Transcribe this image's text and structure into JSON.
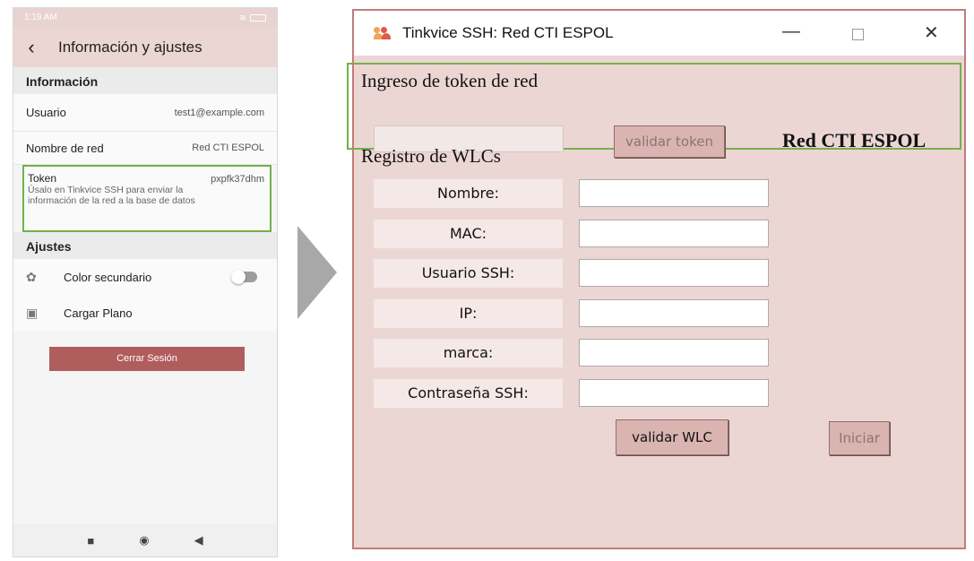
{
  "phone": {
    "status_time": "1:19 AM",
    "back_glyph": "‹",
    "title": "Información y ajustes",
    "info_section": "Información",
    "rows": [
      {
        "label": "Usuario",
        "value": "test1@example.com"
      },
      {
        "label": "Nombre de red",
        "value": "Red CTI ESPOL"
      }
    ],
    "token": {
      "label": "Token",
      "description": "Úsalo en Tinkvice SSH para enviar la información de la red a la base de datos",
      "value": "pxpfk37dhm"
    },
    "settings_section": "Ajustes",
    "settings": [
      {
        "label": "Color secundario",
        "icon": "palette-icon"
      },
      {
        "label": "Cargar Plano",
        "icon": "image-icon"
      }
    ],
    "logout_label": "Cerrar Sesión",
    "nav": {
      "recents": "■",
      "home": "◉",
      "back": "◀"
    }
  },
  "window": {
    "title": "Tinkvice SSH: Red CTI ESPOL",
    "minimize_glyph": "—",
    "close_glyph": "✕",
    "token_heading": "Ingreso de token de red",
    "validate_token_label": "validar token",
    "network_name": "Red CTI ESPOL",
    "wlc_heading": "Registro de WLCs",
    "fields": [
      "Nombre:",
      "MAC:",
      "Usuario SSH:",
      "IP:",
      "marca:",
      "Contraseña SSH:"
    ],
    "validate_wlc_label": "validar WLC",
    "start_label": "Iniciar"
  },
  "colors": {
    "accent_green": "#74b04c",
    "window_bg": "#ecd6d4",
    "logout_bg": "#b05d5d"
  }
}
